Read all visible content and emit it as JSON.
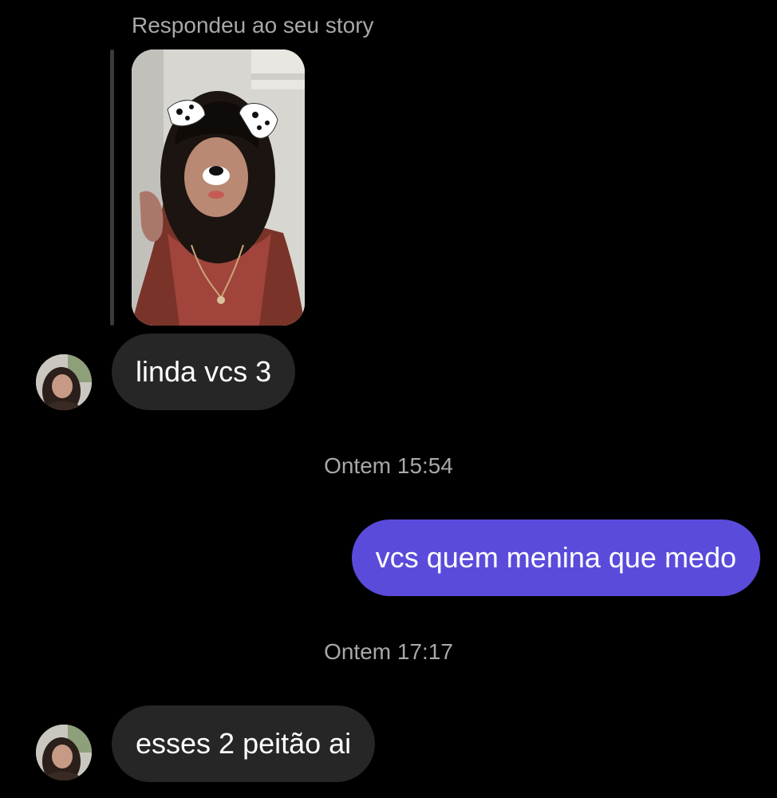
{
  "story_reply": {
    "caption": "Respondeu ao seu story",
    "thumbnail_icon": "story-photo-thumbnail"
  },
  "messages": [
    {
      "direction": "incoming",
      "text": "linda vcs 3",
      "avatar_icon": "contact-avatar"
    },
    {
      "timestamp": "Ontem 15:54"
    },
    {
      "direction": "outgoing",
      "text": "vcs quem menina que medo"
    },
    {
      "timestamp": "Ontem 17:17"
    },
    {
      "direction": "incoming",
      "text": "esses 2 peitão ai",
      "avatar_icon": "contact-avatar"
    }
  ],
  "colors": {
    "background": "#000000",
    "incoming_bubble": "#262626",
    "outgoing_bubble": "#5b4bdb",
    "meta_text": "#a8a8a8"
  }
}
